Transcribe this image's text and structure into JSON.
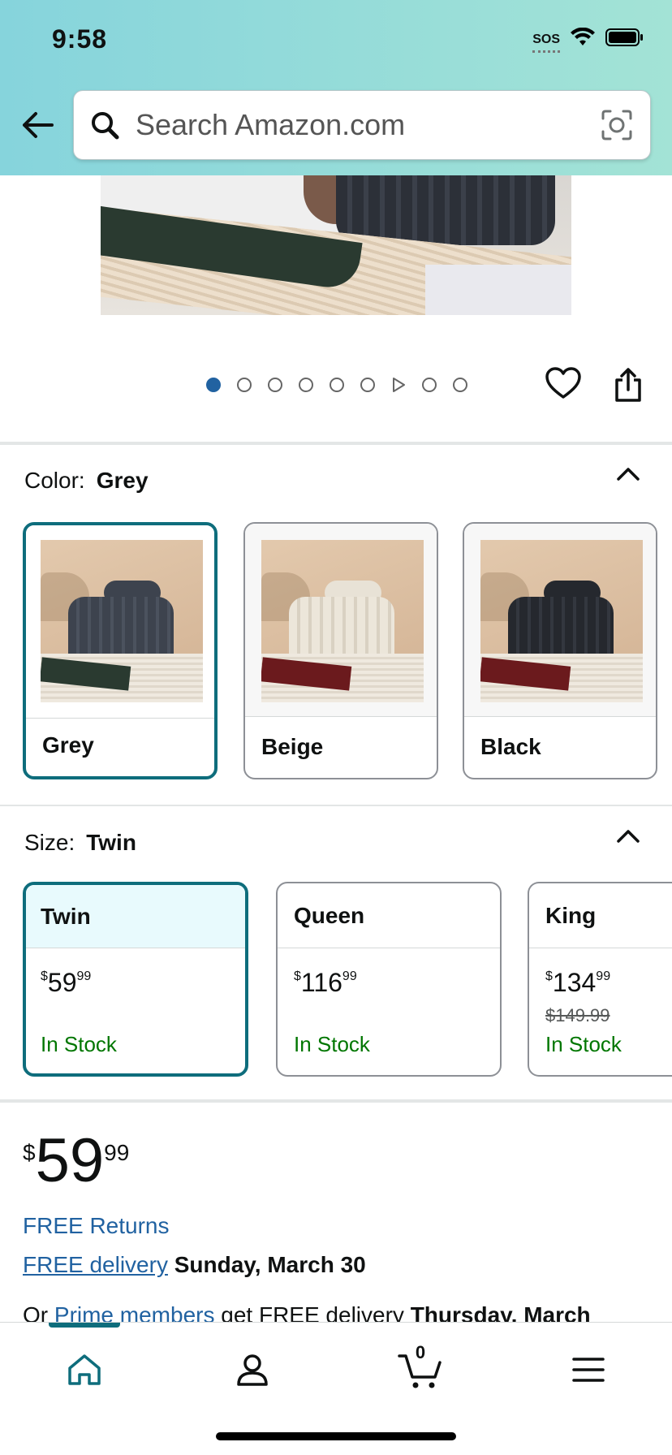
{
  "status_bar": {
    "time": "9:58",
    "sos": "SOS"
  },
  "search": {
    "placeholder": "Search Amazon.com"
  },
  "carousel": {
    "dot_count": 9,
    "active_index": 0
  },
  "color_selector": {
    "label": "Color:",
    "selected": "Grey",
    "options": [
      {
        "label": "Grey",
        "selected": true,
        "cushion_color": "#3d434e",
        "blanket_color": "#2a3a30"
      },
      {
        "label": "Beige",
        "selected": false,
        "cushion_color": "#e8e2d6",
        "blanket_color": "#6b1a1d"
      },
      {
        "label": "Black",
        "selected": false,
        "cushion_color": "#25282e",
        "blanket_color": "#6b1a1d"
      }
    ]
  },
  "size_selector": {
    "label": "Size:",
    "selected": "Twin",
    "options": [
      {
        "label": "Twin",
        "currency": "$",
        "price_whole": "59",
        "price_fraction": "99",
        "list_price": "",
        "stock": "In Stock",
        "selected": true
      },
      {
        "label": "Queen",
        "currency": "$",
        "price_whole": "116",
        "price_fraction": "99",
        "list_price": "",
        "stock": "In Stock",
        "selected": false
      },
      {
        "label": "King",
        "currency": "$",
        "price_whole": "134",
        "price_fraction": "99",
        "list_price": "$149.99",
        "stock": "In Stock",
        "selected": false
      }
    ]
  },
  "price": {
    "currency": "$",
    "whole": "59",
    "fraction": "99"
  },
  "shipping": {
    "free_returns": "FREE Returns",
    "free_delivery_link": "FREE delivery",
    "delivery_date": "Sunday, March 30",
    "prime_prefix": "Or",
    "prime_link": "Prime members",
    "prime_text": "get FREE delivery",
    "prime_date": "Thursday, March"
  },
  "bottom_nav": {
    "cart_count": "0"
  },
  "colors": {
    "accent": "#0e6d7c",
    "link": "#2162a1",
    "in_stock": "#007600",
    "dot_active": "#2162a1"
  }
}
